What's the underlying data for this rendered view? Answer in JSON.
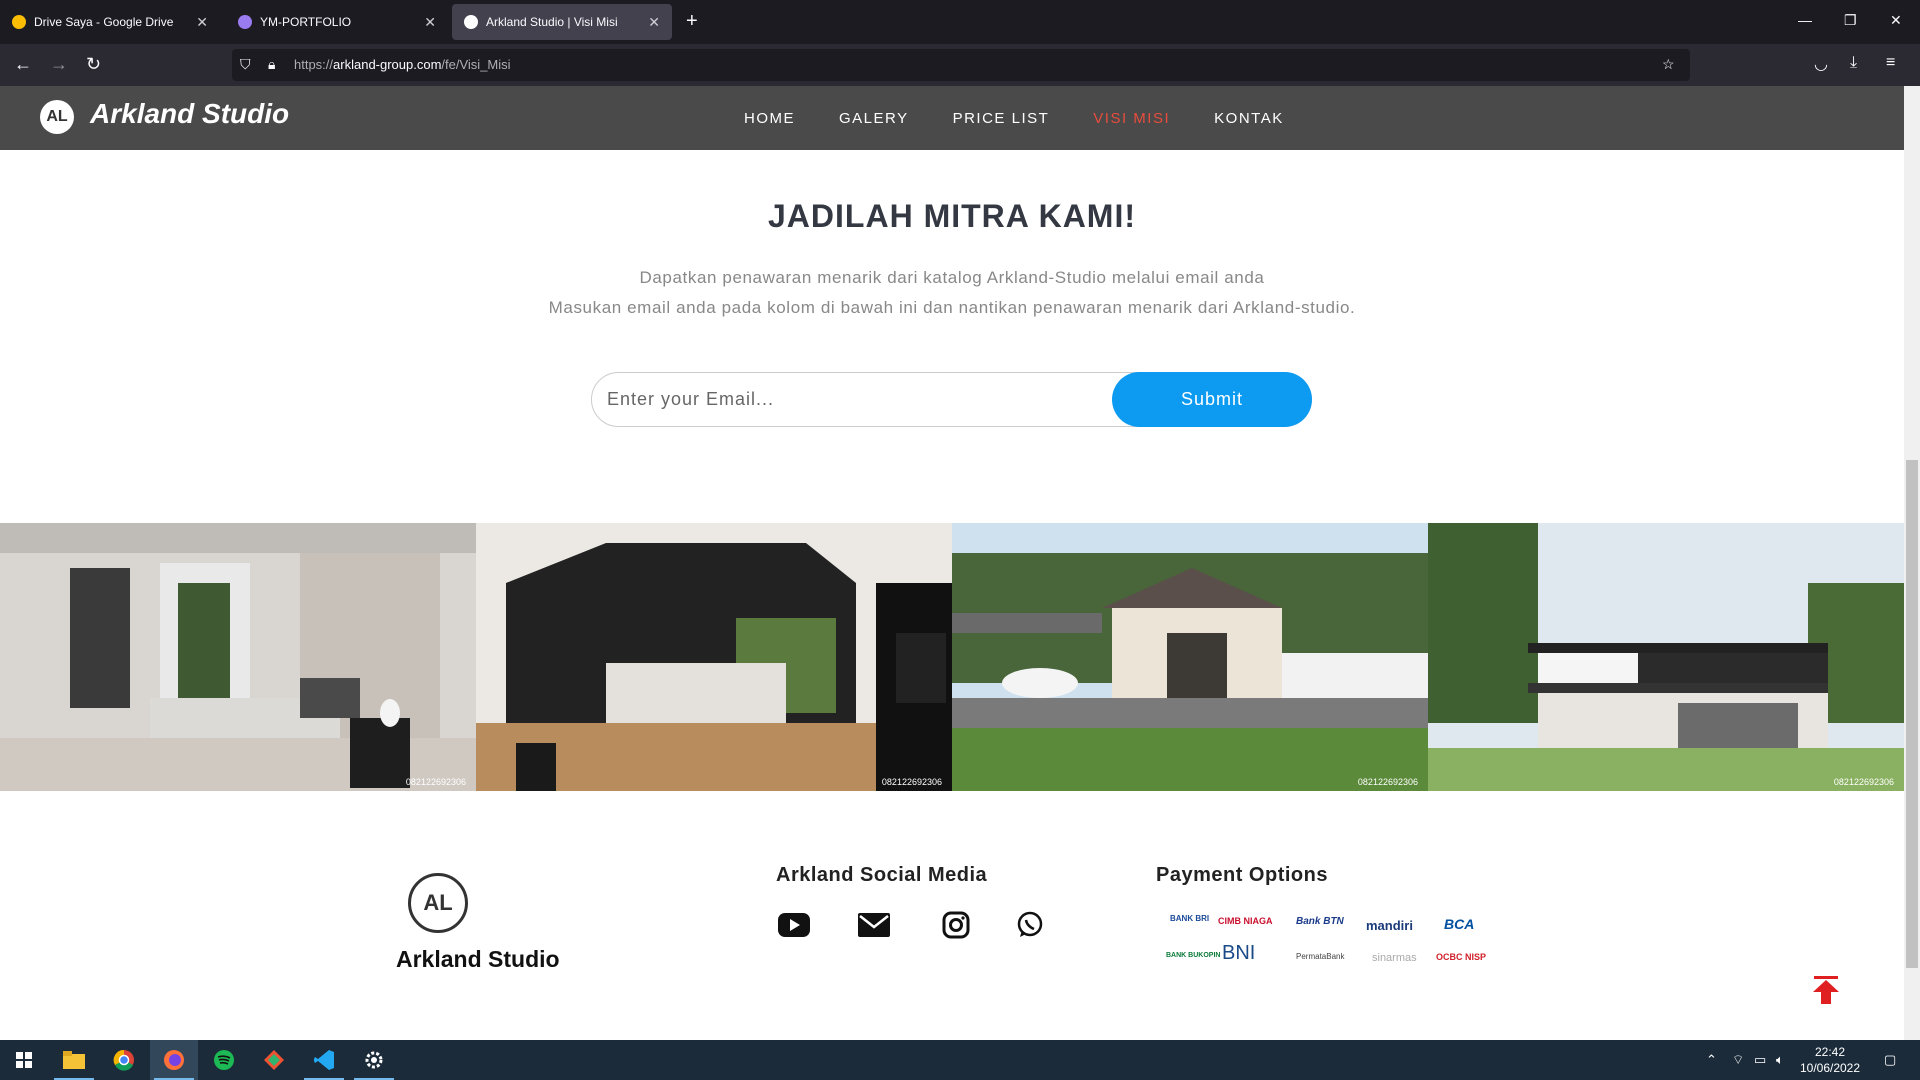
{
  "browser": {
    "tabs": [
      {
        "title": "Drive Saya - Google Drive",
        "favicon_color": "#fbbc04"
      },
      {
        "title": "YM-PORTFOLIO",
        "favicon_color": "#9b7bf0"
      },
      {
        "title": "Arkland Studio | Visi Misi",
        "favicon_color": "#ffffff"
      }
    ],
    "url_prefix": "https://",
    "url_host": "arkland-group.com",
    "url_path": "/fe/Visi_Misi"
  },
  "site": {
    "logo_text": "AL",
    "brand": "Arkland Studio",
    "menu": [
      {
        "label": "HOME",
        "active": false
      },
      {
        "label": "GALERY",
        "active": false
      },
      {
        "label": "PRICE LIST",
        "active": false
      },
      {
        "label": "VISI MISI",
        "active": true
      },
      {
        "label": "KONTAK",
        "active": false
      }
    ],
    "accent": "#e84c3d"
  },
  "subscribe": {
    "title": "JADILAH MITRA KAMI!",
    "line1": "Dapatkan penawaran menarik dari katalog Arkland-Studio melalui email anda",
    "line2": "Masukan email anda pada kolom di bawah ini dan nantikan penawaran menarik dari Arkland-studio.",
    "placeholder": "Enter your Email...",
    "submit": "Submit",
    "button_color": "#0d9bf2"
  },
  "gallery": {
    "watermark": "082122692306",
    "images": [
      "bedroom-interior-1",
      "bedroom-interior-2",
      "house-exterior-tropical",
      "house-exterior-modern"
    ]
  },
  "footer": {
    "brand": "Arkland Studio",
    "logo_text": "AL",
    "social_heading": "Arkland Social Media",
    "social_icons": [
      "youtube-icon",
      "email-icon",
      "instagram-icon",
      "whatsapp-icon"
    ],
    "payment_heading": "Payment Options",
    "banks": [
      "BANK BRI",
      "CIMB NIAGA",
      "Bank BTN",
      "mandiri",
      "BCA",
      "BANK BUKOPIN",
      "BNI",
      "PermataBank",
      "sinarmas",
      "OCBC NISP"
    ]
  },
  "taskbar": {
    "time": "22:42",
    "date": "10/06/2022"
  }
}
